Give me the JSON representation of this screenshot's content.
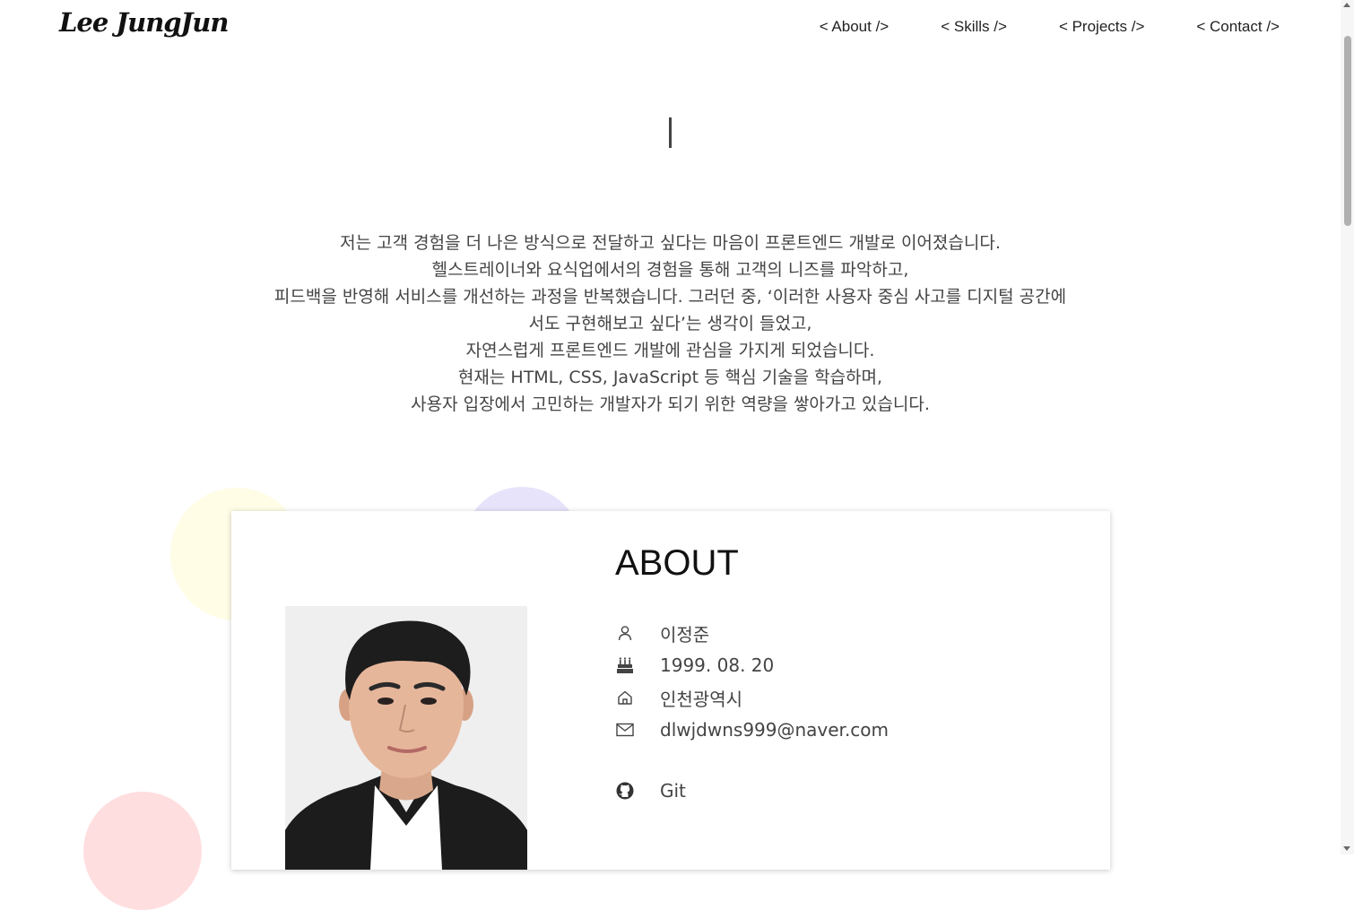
{
  "header": {
    "logo": "Lee JungJun",
    "nav": [
      "< About />",
      "< Skills />",
      "< Projects />",
      "< Contact />"
    ]
  },
  "intro": {
    "lines": [
      "저는 고객 경험을 더 나은 방식으로 전달하고 싶다는 마음이 프론트엔드 개발로 이어졌습니다.",
      "헬스트레이너와 요식업에서의 경험을 통해 고객의 니즈를 파악하고,",
      "피드백을 반영해 서비스를 개선하는 과정을 반복했습니다. 그러던 중, ‘이러한 사용자 중심 사고를 디지털 공간에",
      "서도 구현해보고 싶다’는 생각이 들었고,",
      "자연스럽게 프론트엔드 개발에 관심을 가지게 되었습니다.",
      "현재는 HTML, CSS, JavaScript 등 핵심 기술을 학습하며,",
      "사용자 입장에서 고민하는 개발자가 되기 위한 역량을 쌓아가고 있습니다."
    ]
  },
  "about": {
    "title": "ABOUT",
    "name": "이정준",
    "birth": "1999. 08. 20",
    "location": "인천광역시",
    "email": "dlwjdwns999@naver.com",
    "git": "Git"
  },
  "icons": {
    "name": "user-icon",
    "birth": "cake-icon",
    "location": "home-icon",
    "email": "mail-icon",
    "git": "github-icon"
  },
  "colors": {
    "blob_yellow": "#fffde6",
    "blob_purple": "#e7e3fa",
    "blob_pink": "#ffdedf"
  }
}
